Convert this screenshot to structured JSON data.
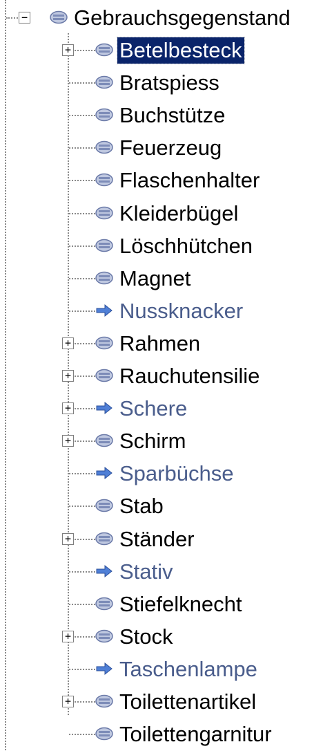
{
  "tree": {
    "root": {
      "label": "Gebrauchsgegenstand",
      "expanded": true,
      "icon": "concept-icon"
    },
    "children": [
      {
        "label": "Betelbesteck",
        "expandable": true,
        "icon": "concept-icon",
        "selected": true
      },
      {
        "label": "Bratspiess",
        "expandable": false,
        "icon": "concept-icon"
      },
      {
        "label": "Buchstütze",
        "expandable": false,
        "icon": "concept-icon"
      },
      {
        "label": "Feuerzeug",
        "expandable": false,
        "icon": "concept-icon"
      },
      {
        "label": "Flaschenhalter",
        "expandable": false,
        "icon": "concept-icon"
      },
      {
        "label": "Kleiderbügel",
        "expandable": false,
        "icon": "concept-icon"
      },
      {
        "label": "Löschhütchen",
        "expandable": false,
        "icon": "concept-icon"
      },
      {
        "label": "Magnet",
        "expandable": false,
        "icon": "concept-icon"
      },
      {
        "label": "Nussknacker",
        "expandable": false,
        "icon": "arrow-icon",
        "link": true
      },
      {
        "label": "Rahmen",
        "expandable": true,
        "icon": "concept-icon"
      },
      {
        "label": "Rauchutensilie",
        "expandable": true,
        "icon": "concept-icon"
      },
      {
        "label": "Schere",
        "expandable": true,
        "icon": "arrow-icon",
        "link": true
      },
      {
        "label": "Schirm",
        "expandable": true,
        "icon": "concept-icon"
      },
      {
        "label": "Sparbüchse",
        "expandable": false,
        "icon": "arrow-icon",
        "link": true
      },
      {
        "label": "Stab",
        "expandable": false,
        "icon": "concept-icon"
      },
      {
        "label": "Ständer",
        "expandable": true,
        "icon": "concept-icon"
      },
      {
        "label": "Stativ",
        "expandable": false,
        "icon": "arrow-icon",
        "link": true
      },
      {
        "label": "Stiefelknecht",
        "expandable": false,
        "icon": "concept-icon"
      },
      {
        "label": "Stock",
        "expandable": true,
        "icon": "concept-icon"
      },
      {
        "label": "Taschenlampe",
        "expandable": false,
        "icon": "arrow-icon",
        "link": true
      },
      {
        "label": "Toilettenartikel",
        "expandable": true,
        "icon": "concept-icon"
      },
      {
        "label": "Toilettengarnitur",
        "expandable": false,
        "icon": "concept-icon"
      }
    ]
  },
  "colors": {
    "selected_bg": "#0a246a",
    "selected_fg": "#ffffff",
    "link_text": "#4a5d8c",
    "normal_text": "#000000",
    "guide_line": "#8a8a8a"
  }
}
